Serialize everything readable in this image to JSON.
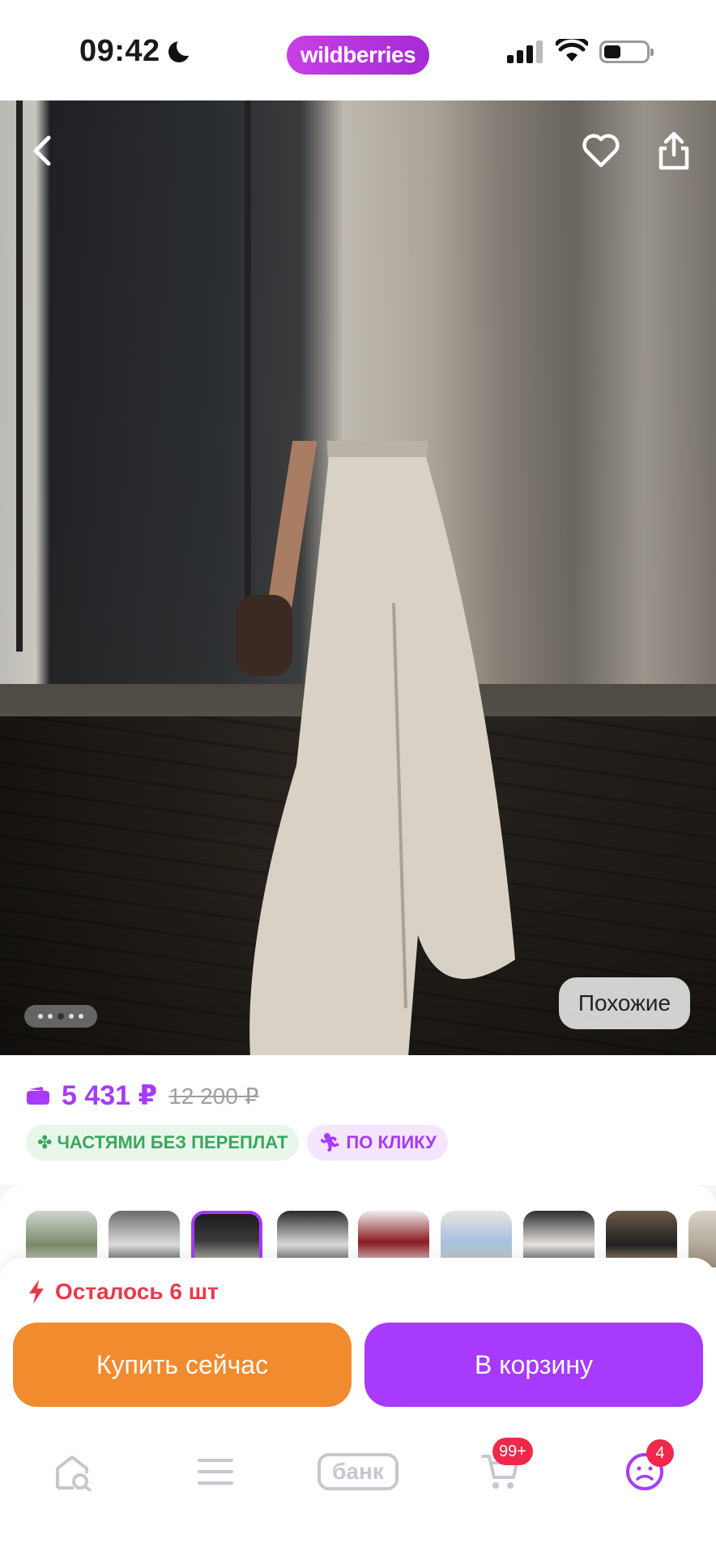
{
  "status_bar": {
    "time": "09:42",
    "brand": "wildberries"
  },
  "photo": {
    "similar_label": "Похожие",
    "gallery_dots": 5,
    "gallery_active_index": 2
  },
  "price": {
    "current": "5 431 ₽",
    "old": "12 200 ₽",
    "badges": {
      "installments": "ЧАСТЯМИ БЕЗ ПЕРЕПЛАТ",
      "one_click": "ПО КЛИКУ"
    }
  },
  "variants": {
    "count_visible": 9,
    "selected_index": 2
  },
  "purchase": {
    "stock_text": "Осталось 6 шт",
    "buy_now_label": "Купить сейчас",
    "add_to_cart_label": "В корзину"
  },
  "tabbar": {
    "bank_label": "банк",
    "cart_badge": "99+",
    "profile_badge": "4"
  },
  "colors": {
    "brand_purple": "#a73afd",
    "buy_orange": "#f28a2e",
    "stock_red": "#e8394b",
    "badge_green": "#3aa85c",
    "notification_red": "#f0294b"
  }
}
